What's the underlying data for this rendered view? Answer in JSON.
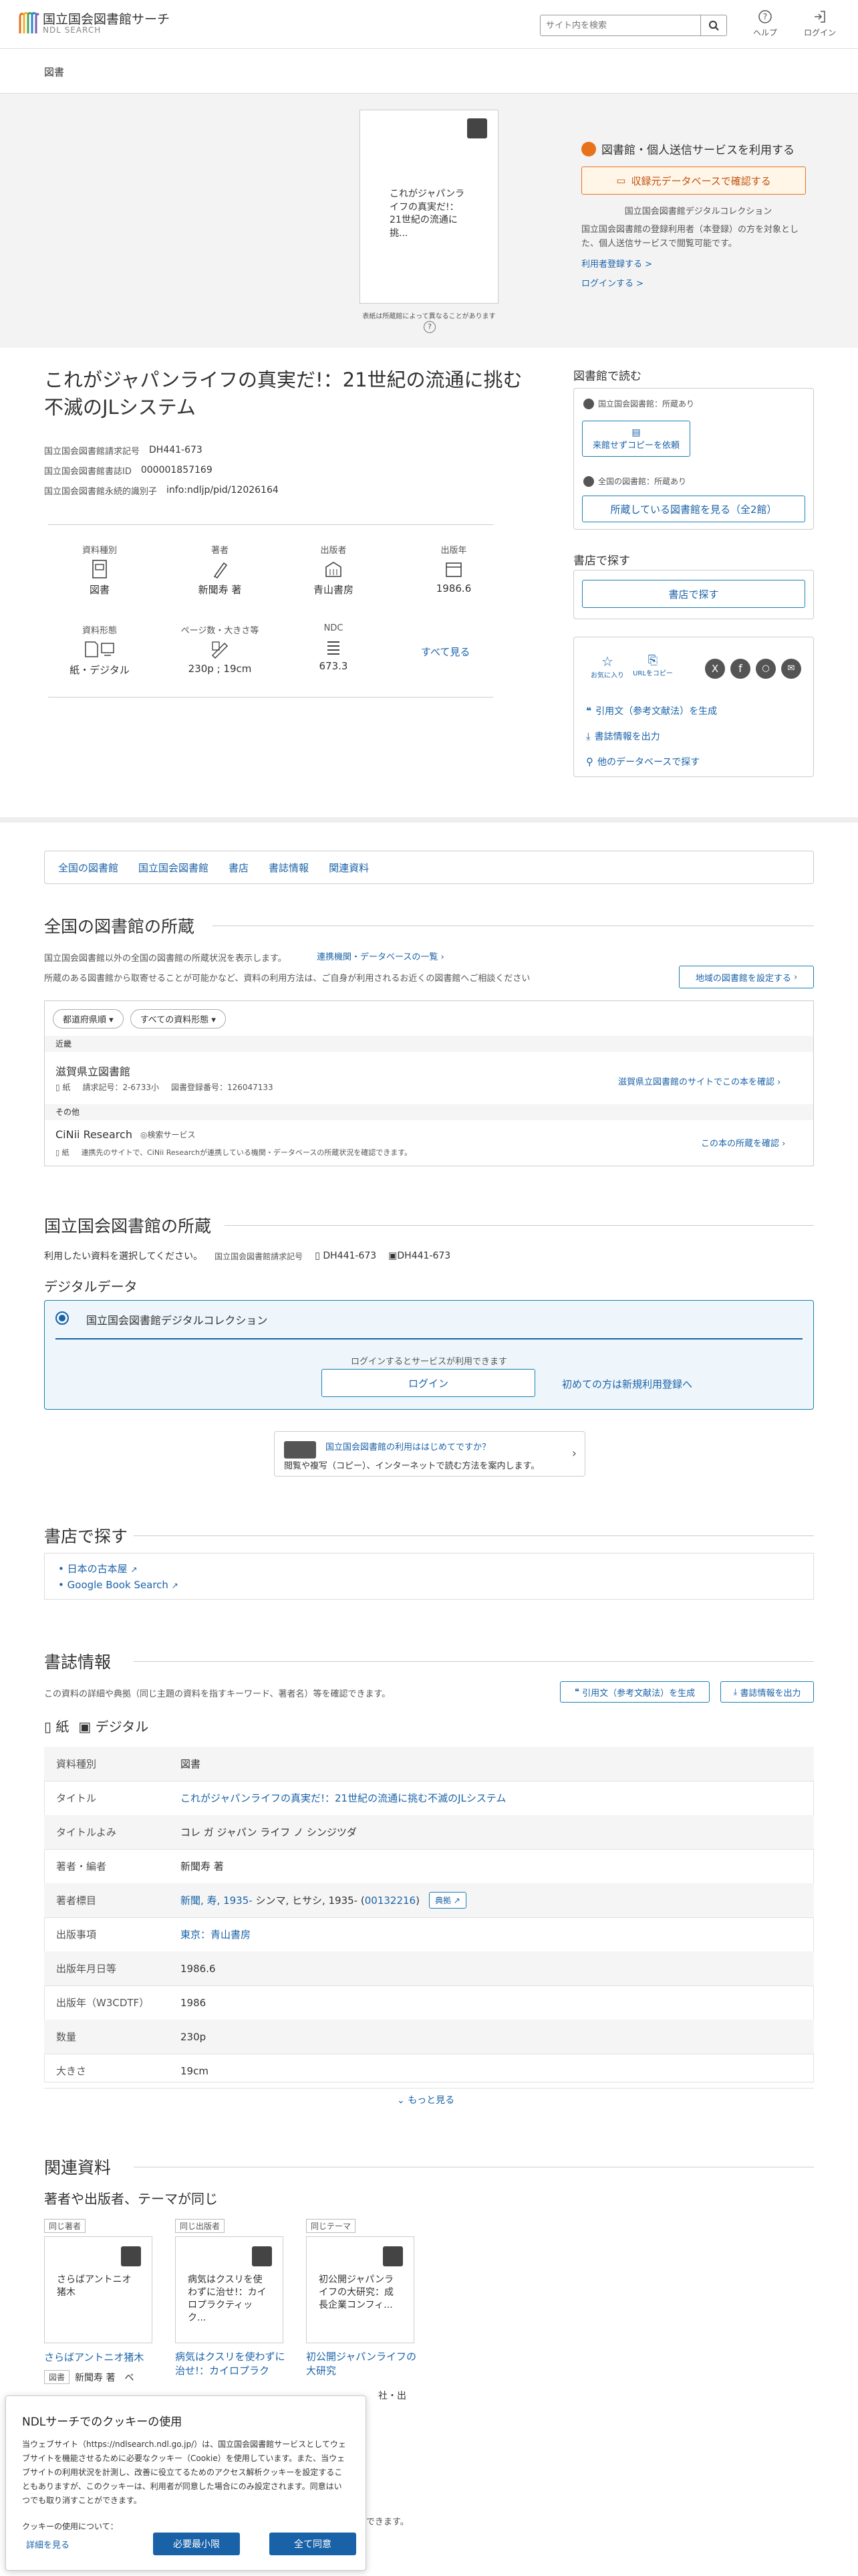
{
  "header": {
    "logo_main": "国立国会図書館サーチ",
    "logo_sub": "NDL SEARCH",
    "search_placeholder": "サイト内を検索",
    "help": "ヘルプ",
    "login": "ログイン"
  },
  "breadcrumb": {
    "current": "図書"
  },
  "hero": {
    "cover_title": "これがジャパンライフの真実だ!：21世紀の流通に挑...",
    "cover_note": "表紙は所蔵館によって異なることがあります",
    "cover_help": "?",
    "service_title": "図書館・個人送信サービスを利用する",
    "check_db_button": "収録元データベースで確認する",
    "collection_name": "国立国会図書館デジタルコレクション",
    "service_desc": "国立国会図書館の登録利用者（本登録）の方を対象とした、個人送信サービスで閲覧可能です。",
    "register_link": "利用者登録する >",
    "login_link": "ログインする >"
  },
  "book": {
    "title": "これがジャパンライフの真実だ!：21世紀の流通に挑む不滅のJLシステム",
    "ids": [
      {
        "label": "国立国会図書館請求記号",
        "value": "DH441-673"
      },
      {
        "label": "国立国会図書館書誌ID",
        "value": "000001857169"
      },
      {
        "label": "国立国会図書館永続的識別子",
        "value": "info:ndljp/pid/12026164"
      }
    ],
    "meta": [
      {
        "label": "資料種別",
        "value": "図書"
      },
      {
        "label": "著者",
        "value": "新聞寿 著"
      },
      {
        "label": "出版者",
        "value": "青山書房"
      },
      {
        "label": "出版年",
        "value": "1986.6"
      },
      {
        "label": "資料形態",
        "value": "紙・デジタル"
      },
      {
        "label": "ページ数・大きさ等",
        "value": "230p ; 19cm"
      },
      {
        "label": "NDC",
        "value": "673.3"
      }
    ],
    "see_all": "すべて見る"
  },
  "side": {
    "read_title": "図書館で読む",
    "ndl_holding": "国立国会図書館：所蔵あり",
    "copy_button": "来館せずコピーを依頼",
    "all_holding": "全国の図書館：所蔵あり",
    "view_libraries_button": "所蔵している図書館を見る（全2館）",
    "shop_title": "書店で探す",
    "shop_button": "書店で探す",
    "favorite": "お気に入り",
    "url_copy": "URLをコピー",
    "cite_link": "引用文（参考文献法）を生成",
    "export_link": "書誌情報を出力",
    "other_db_link": "他のデータベースで探す"
  },
  "tabs": [
    "全国の図書館",
    "国立国会図書館",
    "書店",
    "書誌情報",
    "関連資料"
  ],
  "all_libraries": {
    "heading": "全国の図書館の所蔵",
    "desc1": "国立国会図書館以外の全国の図書館の所蔵状況を表示します。",
    "partner_link": "連携機関・データベースの一覧",
    "desc2": "所蔵のある図書館から取寄せることが可能かなど、資料の利用方法は、ご自身が利用されるお近くの図書館へご相談ください",
    "region_button": "地域の図書館を設定する",
    "filter_pref": "都道府県順",
    "filter_types": "すべての資料形態",
    "group_kinki": "近畿",
    "lib_name": "滋賀県立図書館",
    "lib_kind": "紙",
    "lib_call": "請求記号：2-6733小",
    "lib_reg": "図書登録番号：126047133",
    "lib_link": "滋賀県立図書館のサイトでこの本を確認",
    "group_other": "その他",
    "cinii_name": "CiNii Research",
    "cinii_kind": "検索サービス",
    "cinii_format": "紙",
    "cinii_desc": "連携先のサイトで、CiNii Researchが連携している機関・データベースの所蔵状況を確認できます。",
    "cinii_link": "この本の所蔵を確認"
  },
  "ndl": {
    "heading": "国立国会図書館の所蔵",
    "desc": "利用したい資料を選択してください。",
    "call_label": "国立国会図書館請求記号",
    "call_value1": "DH441-673",
    "call_value2": "DH441-673",
    "digital_heading": "デジタルデータ",
    "dc_name": "国立国会図書館デジタルコレクション",
    "login_note": "ログインするとサービスが利用できます",
    "login_button": "ログイン",
    "register_link": "初めての方は新規利用登録へ",
    "first_time_title": "国立国会図書館の利用ははじめてですか？",
    "first_time_desc": "閲覧や複写（コピー）、インターネットで読む方法を案内します。"
  },
  "bookstore": {
    "heading": "書店で探す",
    "links": [
      "日本の古本屋",
      "Google Book Search"
    ]
  },
  "biblio": {
    "heading": "書誌情報",
    "desc": "この資料の詳細や典拠（同じ主題の資料を指すキーワード、著者名）等を確認できます。",
    "cite_button": "引用文（参考文献法）を生成",
    "export_button": "書誌情報を出力",
    "format_paper": "紙",
    "format_digital": "デジタル",
    "rows": [
      {
        "k": "資料種別",
        "v": "図書"
      },
      {
        "k": "タイトル",
        "v": "これがジャパンライフの真実だ!：21世紀の流通に挑む不滅のJLシステム"
      },
      {
        "k": "タイトルよみ",
        "v": "コレ ガ ジャパン ライフ ノ シンジツダ"
      },
      {
        "k": "著者・編者",
        "v": "新聞寿 著"
      },
      {
        "k": "著者標目",
        "v": "新聞, 寿, 1935-"
      },
      {
        "k": "出版事項",
        "v": "東京：青山書房"
      },
      {
        "k": "出版年月日等",
        "v": "1986.6"
      },
      {
        "k": "出版年（W3CDTF）",
        "v": "1986"
      },
      {
        "k": "数量",
        "v": "230p"
      },
      {
        "k": "大きさ",
        "v": "19cm"
      }
    ],
    "author_heading_rest": " シンマ, ヒサシ, 1935- (",
    "author_heading_id": "00132216",
    "author_heading_close": ")",
    "authority_button": "典拠",
    "more": "もっと見る"
  },
  "related": {
    "heading": "関連資料",
    "sub": "著者や出版者、テーマが同じ",
    "items": [
      {
        "tag": "同じ著者",
        "thumb": "さらばアントニオ猪木",
        "title": "さらばアントニオ猪木",
        "meta": "新聞寿 著"
      },
      {
        "tag": "同じ出版者",
        "thumb": "病気はクスリを使わずに治せ!：カイロプラクティック...",
        "title": "病気はクスリを使わずに治せ!：カイロプラク",
        "meta": ""
      },
      {
        "tag": "同じテーマ",
        "thumb": "初公開ジャパンライフの大研究：成長企業コンフィ...",
        "title": "初公開ジャパンライフの大研究",
        "meta": "社・出"
      }
    ],
    "item_type": "図書",
    "item_author_cut": "新聞寿 著　ベ"
  },
  "cookie": {
    "title": "NDLサーチでのクッキーの使用",
    "body": "当ウェブサイト（https://ndlsearch.ndl.go.jp/）は、国立国会図書館サービスとしてウェブサイトを機能させるために必要なクッキー（Cookie）を使用しています。また、当ウェブサイトの利用状況を計測し、改善に役立てるためのアクセス解析クッキーを設定することもありますが、このクッキーは、利用者が同意した場合にのみ設定されます。同意はいつでも取り消すことができます。",
    "about": "クッキーの使用について：",
    "detail_link": "詳細を見る",
    "minimal_button": "必要最小限",
    "agree_button": "全て同意"
  },
  "footer_cut": "できます。",
  "colors": {
    "primary": "#1a62a8",
    "accent_orange": "#e8711c",
    "border": "#cccccc"
  }
}
